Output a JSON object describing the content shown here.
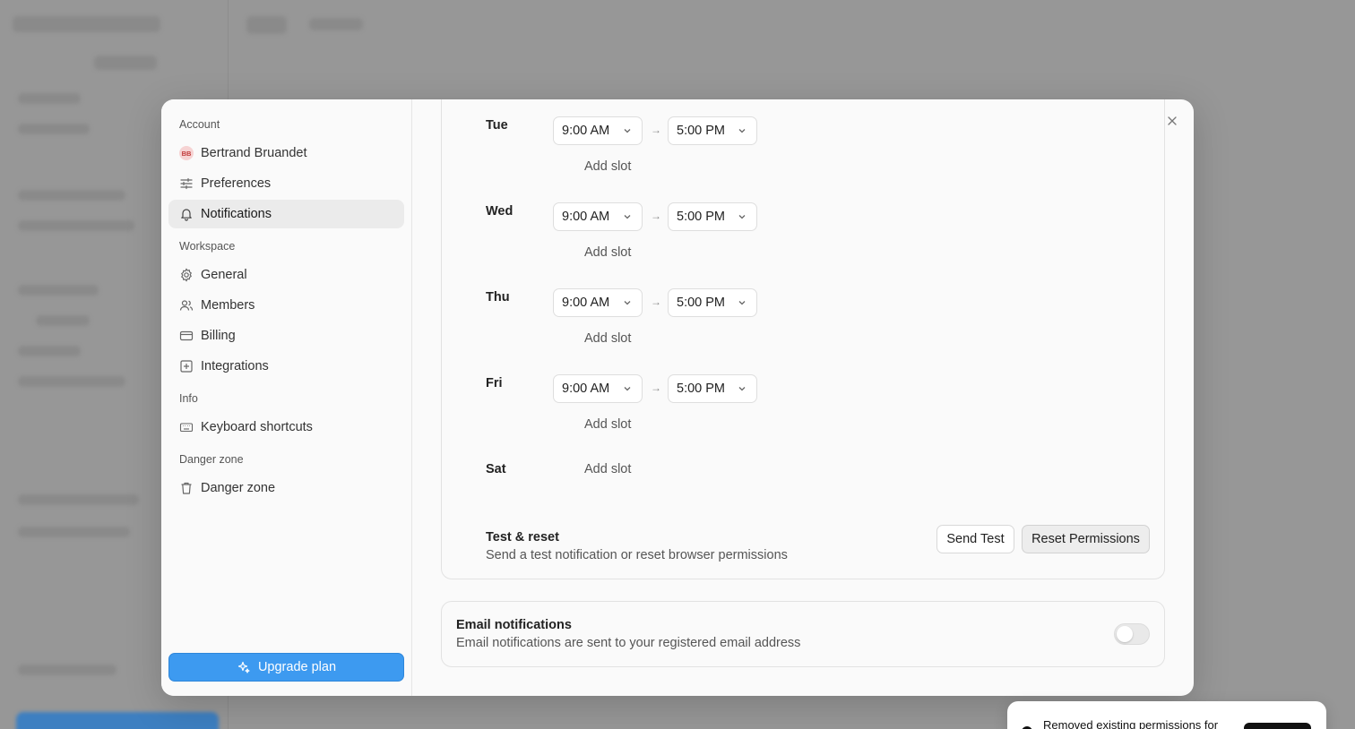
{
  "nav": {
    "sections": {
      "account": "Account",
      "workspace": "Workspace",
      "info": "Info",
      "danger": "Danger zone"
    },
    "user": {
      "initials": "BB",
      "name": "Bertrand Bruandet"
    },
    "items": {
      "preferences": "Preferences",
      "notifications": "Notifications",
      "general": "General",
      "members": "Members",
      "billing": "Billing",
      "integrations": "Integrations",
      "shortcuts": "Keyboard shortcuts",
      "danger_zone": "Danger zone"
    },
    "upgrade_label": "Upgrade plan"
  },
  "schedule": {
    "arrow": "→",
    "add_slot": "Add slot",
    "days": [
      {
        "label": "Tue",
        "start": "9:00 AM",
        "end": "5:00 PM"
      },
      {
        "label": "Wed",
        "start": "9:00 AM",
        "end": "5:00 PM"
      },
      {
        "label": "Thu",
        "start": "9:00 AM",
        "end": "5:00 PM"
      },
      {
        "label": "Fri",
        "start": "9:00 AM",
        "end": "5:00 PM"
      },
      {
        "label": "Sat"
      }
    ]
  },
  "test_reset": {
    "title": "Test & reset",
    "description": "Send a test notification or reset browser permissions",
    "send_test": "Send Test",
    "reset": "Reset Permissions"
  },
  "email": {
    "title": "Email notifications",
    "description": "Email notifications are sent to your registered email address",
    "enabled": false
  },
  "toast": {
    "text": "Removed existing permissions for"
  },
  "colors": {
    "accent": "#3d9af0",
    "avatar_bg": "#f6d3d3",
    "avatar_fg": "#c23b3b"
  }
}
